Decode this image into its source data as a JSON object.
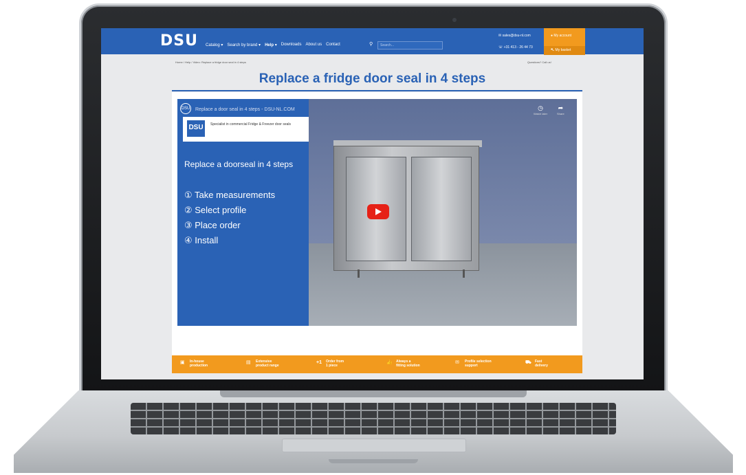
{
  "header": {
    "logo": "DSU",
    "nav": [
      "Catalog ▾",
      "Search by brand ▾",
      "Help ▾",
      "Downloads",
      "About us",
      "Contact"
    ],
    "search_placeholder": "Search...",
    "email": "sales@dsu-nl.com",
    "phone": "+31 413 - 26 44 73",
    "account": "My account",
    "basket": "My basket"
  },
  "breadcrumb": "Home / Help / Video: Replace a fridge door seal in 4 steps",
  "breadcrumb_right": "Questions? Call us!",
  "page": {
    "title": "Replace a fridge door seal in 4 steps"
  },
  "video": {
    "title": "Replace a door seal in 4 steps - DSU-NL.COM",
    "brand_logo": "DSU",
    "brand_text": "Specialist in commercial Fridge & Freezer door seals",
    "heading": "Replace a doorseal in 4 steps",
    "steps": [
      "① Take measurements",
      "② Select profile",
      "③ Place order",
      "④ Install"
    ],
    "watch_later": "Watch later",
    "share": "Share"
  },
  "features": [
    {
      "icon": "factory-icon",
      "glyph": "▣",
      "label": "In-house\nproduction"
    },
    {
      "icon": "range-icon",
      "glyph": "▤",
      "label": "Extensive\nproduct range"
    },
    {
      "icon": "one-icon",
      "glyph": "+1",
      "label": "Order from\n1 piece"
    },
    {
      "icon": "thumb-icon",
      "glyph": "👍",
      "label": "Always a\nfitting solution"
    },
    {
      "icon": "support-icon",
      "glyph": "✉",
      "label": "Profile selection\nsupport"
    },
    {
      "icon": "truck-icon",
      "glyph": "⛟",
      "label": "Fast\ndelivery"
    }
  ],
  "colors": {
    "brand_blue": "#2a62b5",
    "accent_orange": "#f29a1e",
    "play_red": "#e62117"
  }
}
